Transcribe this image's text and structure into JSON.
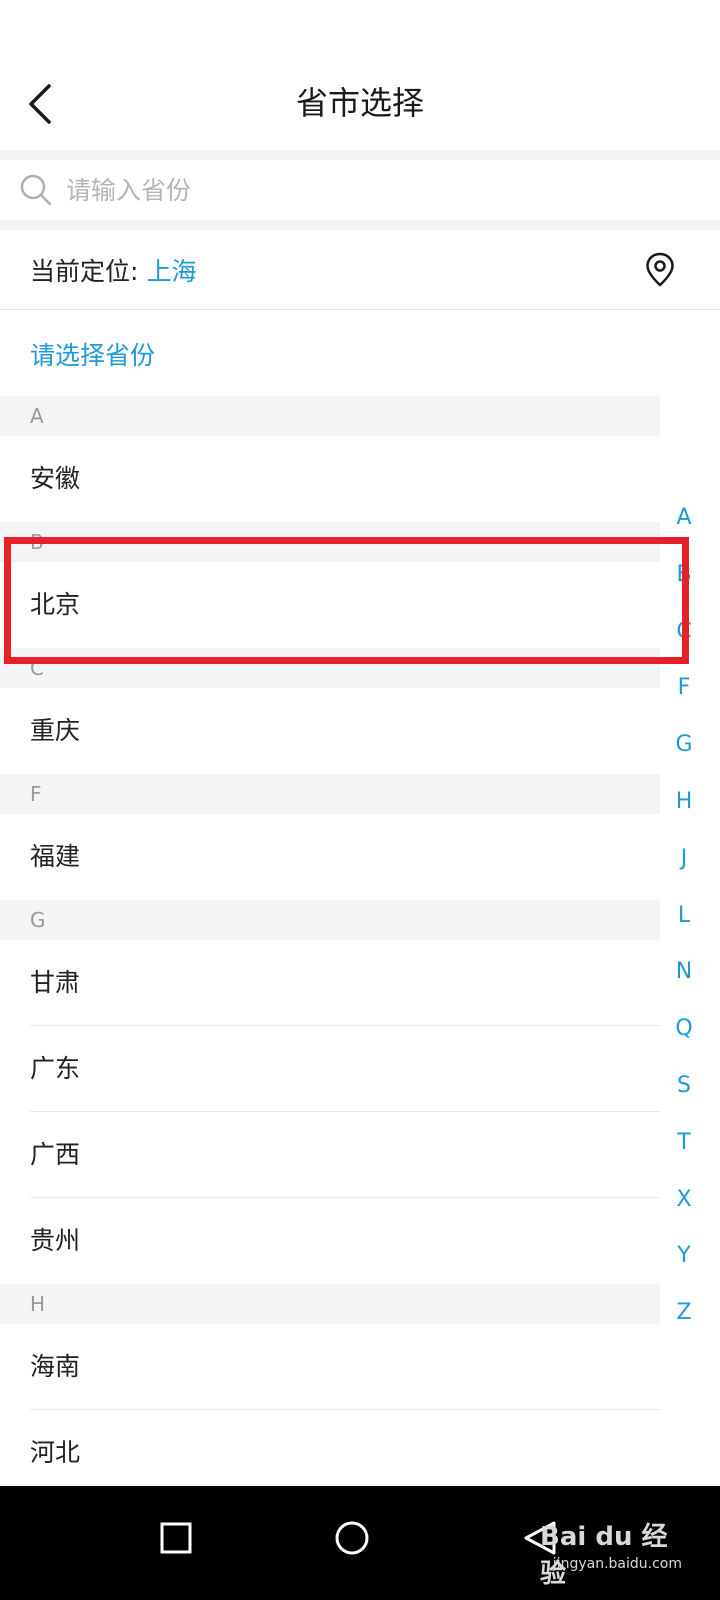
{
  "header": {
    "title": "省市选择"
  },
  "search": {
    "placeholder": "请输入省份"
  },
  "location": {
    "label": "当前定位:",
    "city": "上海"
  },
  "prompt": "请选择省份",
  "groups": [
    {
      "letter": "A",
      "items": [
        "安徽"
      ]
    },
    {
      "letter": "B",
      "items": [
        "北京"
      ]
    },
    {
      "letter": "C",
      "items": [
        "重庆"
      ]
    },
    {
      "letter": "F",
      "items": [
        "福建"
      ]
    },
    {
      "letter": "G",
      "items": [
        "甘肃",
        "广东",
        "广西",
        "贵州"
      ]
    },
    {
      "letter": "H",
      "items": [
        "海南",
        "河北"
      ]
    }
  ],
  "index_letters": [
    "A",
    "B",
    "C",
    "F",
    "G",
    "H",
    "J",
    "L",
    "N",
    "Q",
    "S",
    "T",
    "X",
    "Y",
    "Z"
  ],
  "watermark": {
    "brand": "Bai du 经验",
    "url": "jingyan.baidu.com"
  },
  "colors": {
    "accent": "#1e9ad6",
    "highlight": "#e8202a",
    "group_bg": "#f5f5f5"
  },
  "icons": {
    "back": "chevron-left-icon",
    "search": "search-icon",
    "location": "map-pin-icon"
  }
}
